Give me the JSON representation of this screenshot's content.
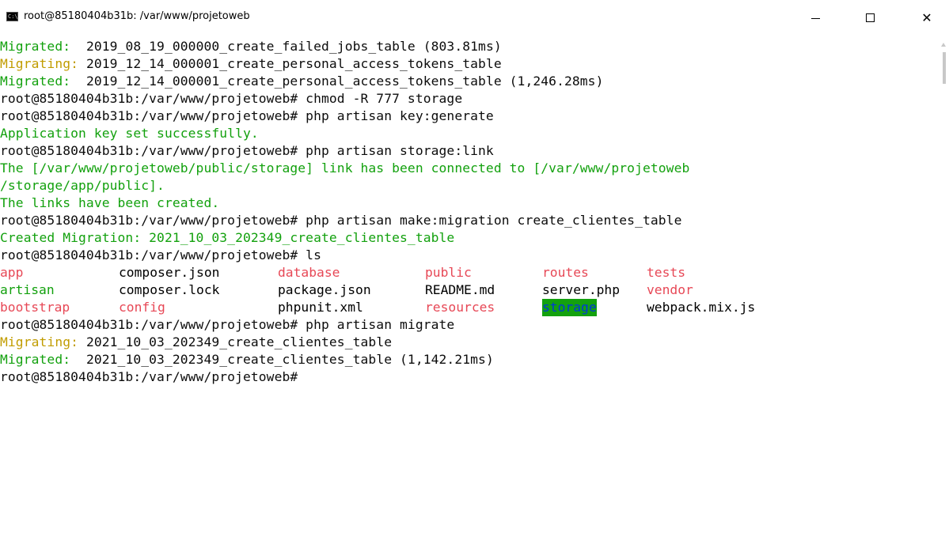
{
  "window": {
    "title": "root@85180404b31b: /var/www/projetoweb",
    "icon": "cmd-icon",
    "icon_text": "C:\\",
    "controls": [
      "minimize",
      "maximize",
      "close"
    ],
    "close_glyph": "✕"
  },
  "colors": {
    "background": "#ffffff",
    "text": "#0c0c0c",
    "green": "#13a10e",
    "yellow": "#c19c00",
    "red": "#e74856",
    "highlight_bg": "#13a10e",
    "highlight_fg": "#0037da"
  },
  "terminal": {
    "lines": [
      {
        "label": "Migrated:  ",
        "label_color": "green",
        "text": "2019_08_19_000000_create_failed_jobs_table (803.81ms)"
      },
      {
        "label": "Migrating: ",
        "label_color": "yellow",
        "text": "2019_12_14_000001_create_personal_access_tokens_table"
      },
      {
        "label": "Migrated:  ",
        "label_color": "green",
        "text": "2019_12_14_000001_create_personal_access_tokens_table (1,246.28ms)"
      },
      {
        "label": "",
        "label_color": "",
        "text": "root@85180404b31b:/var/www/projetoweb# chmod -R 777 storage"
      },
      {
        "label": "",
        "label_color": "",
        "text": "root@85180404b31b:/var/www/projetoweb# php artisan key:generate"
      },
      {
        "label": "Application key set successfully.",
        "label_color": "green",
        "text": ""
      },
      {
        "label": "",
        "label_color": "",
        "text": "root@85180404b31b:/var/www/projetoweb# php artisan storage:link"
      },
      {
        "label": "The [/var/www/projetoweb/public/storage] link has been connected to [/var/www/projetoweb",
        "label_color": "green",
        "text": ""
      },
      {
        "label": "/storage/app/public].",
        "label_color": "green",
        "text": ""
      },
      {
        "label": "The links have been created.",
        "label_color": "green",
        "text": ""
      },
      {
        "label": "",
        "label_color": "",
        "text": "root@85180404b31b:/var/www/projetoweb# php artisan make:migration create_clientes_table"
      },
      {
        "label": "Created Migration: 2021_10_03_202349_create_clientes_table",
        "label_color": "green",
        "text": ""
      },
      {
        "label": "",
        "label_color": "",
        "text": "root@85180404b31b:/var/www/projetoweb# ls"
      }
    ],
    "ls_output": [
      [
        {
          "name": "app",
          "color": "red"
        },
        {
          "name": "composer.json",
          "color": ""
        },
        {
          "name": "database",
          "color": "red"
        },
        {
          "name": "public",
          "color": "red"
        },
        {
          "name": "routes",
          "color": "red"
        },
        {
          "name": "tests",
          "color": "red"
        }
      ],
      [
        {
          "name": "artisan",
          "color": "green"
        },
        {
          "name": "composer.lock",
          "color": ""
        },
        {
          "name": "package.json",
          "color": ""
        },
        {
          "name": "README.md",
          "color": ""
        },
        {
          "name": "server.php",
          "color": ""
        },
        {
          "name": "vendor",
          "color": "red"
        }
      ],
      [
        {
          "name": "bootstrap",
          "color": "red"
        },
        {
          "name": "config",
          "color": "red"
        },
        {
          "name": "phpunit.xml",
          "color": ""
        },
        {
          "name": "resources",
          "color": "red"
        },
        {
          "name": "storage",
          "color": "highlight"
        },
        {
          "name": "webpack.mix.js",
          "color": ""
        }
      ]
    ],
    "after_lines": [
      {
        "label": "",
        "label_color": "",
        "text": "root@85180404b31b:/var/www/projetoweb# php artisan migrate"
      },
      {
        "label": "Migrating: ",
        "label_color": "yellow",
        "text": "2021_10_03_202349_create_clientes_table"
      },
      {
        "label": "Migrated:  ",
        "label_color": "green",
        "text": "2021_10_03_202349_create_clientes_table (1,142.21ms)"
      },
      {
        "label": "",
        "label_color": "",
        "text": "root@85180404b31b:/var/www/projetoweb#"
      }
    ]
  }
}
